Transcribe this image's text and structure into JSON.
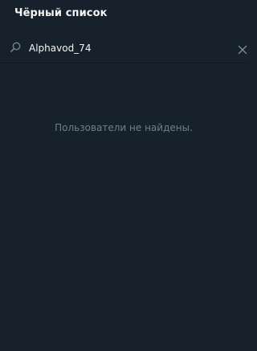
{
  "header": {
    "title": "Чёрный список"
  },
  "search": {
    "value": "Alphavod_74",
    "icon": "search-icon"
  },
  "clear": {
    "icon": "close-icon"
  },
  "results": {
    "empty_message": "Пользователи не найдены."
  },
  "colors": {
    "background": "#17212b",
    "text": "#f5f5f5",
    "muted_text": "#6d7f8f",
    "icon": "#6d7f8f"
  }
}
